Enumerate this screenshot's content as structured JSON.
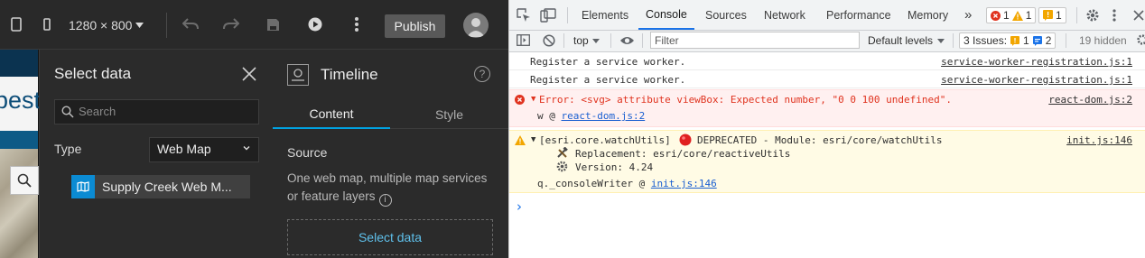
{
  "app": {
    "toolbar": {
      "size_label": "1280 × 800",
      "publish_label": "Publish"
    },
    "map_preview": {
      "title_fragment": "pest"
    },
    "select_data": {
      "title": "Select data",
      "search_placeholder": "Search",
      "type_label": "Type",
      "type_value": "Web Map",
      "item_label": "Supply Creek Web M..."
    },
    "timeline": {
      "title": "Timeline",
      "tabs": [
        {
          "label": "Content"
        },
        {
          "label": "Style"
        }
      ],
      "source_heading": "Source",
      "source_desc": "One web map, multiple map services or feature layers",
      "select_button": "Select data"
    }
  },
  "devtools": {
    "tabs": [
      {
        "label": "Elements"
      },
      {
        "label": "Console"
      },
      {
        "label": "Sources"
      },
      {
        "label": "Network"
      },
      {
        "label": "Performance"
      },
      {
        "label": "Memory"
      }
    ],
    "more_tabs": "»",
    "error_count": "1",
    "warning_count": "1",
    "issue_badge_count": "1",
    "toolbar": {
      "context": "top",
      "filter_placeholder": "Filter",
      "levels": "Default levels",
      "issues_label": "3 Issues:",
      "issues_warn": "1",
      "issues_info": "2",
      "hidden": "19 hidden"
    },
    "console": {
      "logs": [
        {
          "message": "Register a service worker.",
          "source": "service-worker-registration.js:1"
        },
        {
          "message": "Register a service worker.",
          "source": "service-worker-registration.js:1"
        }
      ],
      "error": {
        "message": "Error: <svg> attribute viewBox: Expected number, \"0 0 100 undefined\".",
        "source": "react-dom.js:2",
        "stack_fn": "w @",
        "stack_link": "react-dom.js:2"
      },
      "warning": {
        "prefix": "[esri.core.watchUtils]",
        "message": "DEPRECATED - Module: esri/core/watchUtils",
        "source": "init.js:146",
        "replacement": "Replacement: esri/core/reactiveUtils",
        "version": "Version: 4.24",
        "stack_fn": "q._consoleWriter @",
        "stack_link": "init.js:146"
      },
      "prompt": "›"
    },
    "colors": {
      "accent": "#1a73e8",
      "error": "#e0331f",
      "warning_bg": "#fffbe5",
      "error_bg": "#fff0f0"
    }
  }
}
